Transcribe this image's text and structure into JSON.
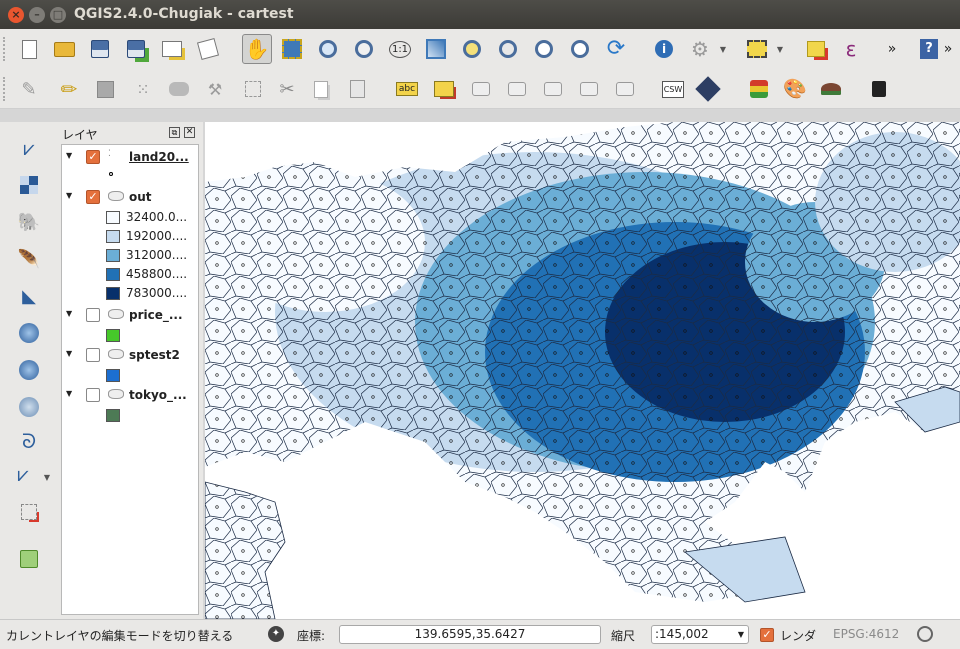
{
  "window": {
    "title": "QGIS2.4.0-Chugiak - cartest"
  },
  "toolbar_top": {
    "icons": [
      "new-project-icon",
      "open-project-icon",
      "save-project-icon",
      "save-as-icon",
      "new-print-composer-icon",
      "composer-manager-icon",
      "pan-icon",
      "pan-to-selection-icon",
      "zoom-in-icon",
      "zoom-out-icon",
      "zoom-actual-icon",
      "zoom-full-icon",
      "zoom-selection-icon",
      "zoom-layer-icon",
      "zoom-last-icon",
      "zoom-next-icon",
      "refresh-icon",
      "identify-icon",
      "action-icon",
      "select-icon",
      "deselect-icon",
      "expression-icon",
      "help-icon"
    ],
    "overflow_label": "»"
  },
  "toolbar_second": {
    "icons": [
      "edits-icon",
      "toggle-edit-icon",
      "save-edits-icon",
      "add-feature-icon",
      "move-feature-icon",
      "node-tool-icon",
      "delete-selected-icon",
      "cut-features-icon",
      "copy-features-icon",
      "paste-features-icon",
      "label-icon",
      "layer-labeling-icon",
      "pin-labels-icon",
      "show-hide-labels-icon",
      "move-label-icon",
      "rotate-label-icon",
      "change-label-icon",
      "csw-icon",
      "georeferencer-icon",
      "gps-icon",
      "style-icon",
      "terrain-icon",
      "console-icon"
    ],
    "csw_label": "CSW",
    "label_abc": "abc",
    "overflow_label": "»"
  },
  "leftbar": {
    "icons": [
      "add-vector-layer-icon",
      "add-raster-layer-icon",
      "add-postgis-layer-icon",
      "add-spatialite-layer-icon",
      "add-mssql-layer-icon",
      "add-wms-layer-icon",
      "add-wcs-layer-icon",
      "add-wfs-layer-icon",
      "add-delimited-text-icon",
      "new-shapefile-icon",
      "remove-layer-icon",
      "new-gpx-icon"
    ]
  },
  "layers_panel": {
    "title": "レイヤ",
    "layers": [
      {
        "name": "land20...",
        "checked": true,
        "expanded": true,
        "selected": true,
        "legend": []
      },
      {
        "name": "out",
        "checked": true,
        "expanded": true,
        "legend": [
          {
            "label": "32400.0...",
            "color": "#f7fbff"
          },
          {
            "label": "192000....",
            "color": "#c6dbef"
          },
          {
            "label": "312000....",
            "color": "#6baed6"
          },
          {
            "label": "458800....",
            "color": "#2171b5"
          },
          {
            "label": "783000....",
            "color": "#08306b"
          }
        ]
      },
      {
        "name": "price_...",
        "checked": false,
        "expanded": true,
        "legend": [
          {
            "label": "",
            "color": "#46c82a"
          }
        ]
      },
      {
        "name": "sptest2",
        "checked": false,
        "expanded": true,
        "legend": [
          {
            "label": "",
            "color": "#1c6fd1"
          }
        ]
      },
      {
        "name": "tokyo_...",
        "checked": false,
        "expanded": true,
        "legend": [
          {
            "label": "",
            "color": "#4d7a55"
          }
        ]
      }
    ]
  },
  "statusbar": {
    "message": "カレントレイヤの編集モードを切り替える",
    "coord_label": "座標:",
    "coord_value": "139.6595,35.6427",
    "scale_label": "縮尺",
    "scale_value": ":145,002",
    "render_label": "レンダ",
    "render_checked": true,
    "crs_label": "EPSG:4612"
  }
}
